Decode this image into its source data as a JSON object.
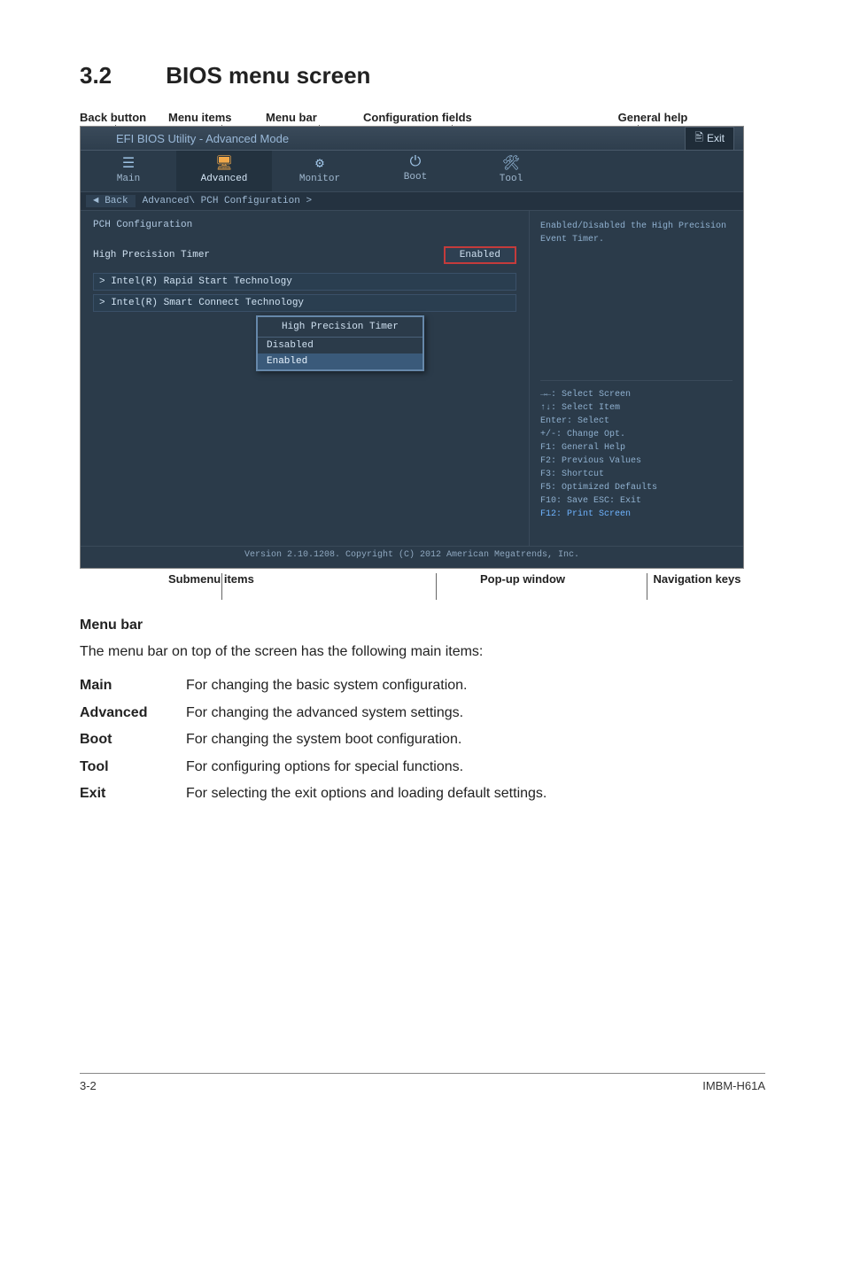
{
  "heading": {
    "num": "3.2",
    "title": "BIOS menu screen"
  },
  "top_labels": [
    "Back button",
    "Menu items",
    "Menu bar",
    "Configuration fields",
    "General help"
  ],
  "bios": {
    "title": "EFI BIOS Utility - Advanced Mode",
    "exit": "Exit",
    "tabs": [
      {
        "icon": "☰",
        "label": "Main"
      },
      {
        "icon": "🖥",
        "label": "Advanced"
      },
      {
        "icon": "⚙",
        "label": "Monitor"
      },
      {
        "icon": "⏻",
        "label": "Boot"
      },
      {
        "icon": "🛠",
        "label": "Tool"
      }
    ],
    "back_button": "Back",
    "breadcrumb": "Advanced\\ PCH Configuration >",
    "left": {
      "section_title": "PCH Configuration",
      "hpt_label": "High Precision Timer",
      "hpt_value": "Enabled",
      "subitems": [
        "> Intel(R) Rapid Start Technology",
        "> Intel(R) Smart Connect Technology"
      ]
    },
    "popup": {
      "title": "High Precision Timer",
      "items": [
        "Disabled",
        "Enabled"
      ],
      "selected": "Enabled"
    },
    "help_text": "Enabled/Disabled the High Precision Event Timer.",
    "nav_keys": [
      "→←: Select Screen",
      "↑↓: Select Item",
      "Enter: Select",
      "+/-: Change Opt.",
      "F1: General Help",
      "F2: Previous Values",
      "F3: Shortcut",
      "F5: Optimized Defaults",
      "F10: Save  ESC: Exit",
      "F12: Print Screen"
    ],
    "footer": "Version 2.10.1208. Copyright (C) 2012 American Megatrends, Inc."
  },
  "bottom_labels": [
    "Submenu items",
    "Pop-up window",
    "Navigation keys"
  ],
  "menu_bar_section": {
    "title": "Menu bar",
    "intro": "The menu bar on top of the screen has the following main items:",
    "rows": [
      {
        "term": "Main",
        "desc": "For changing the basic system configuration."
      },
      {
        "term": "Advanced",
        "desc": "For changing the advanced system settings."
      },
      {
        "term": "Boot",
        "desc": "For changing the system boot configuration."
      },
      {
        "term": "Tool",
        "desc": "For configuring options for special functions."
      },
      {
        "term": "Exit",
        "desc": "For selecting the exit options and loading default settings."
      }
    ]
  },
  "footer": {
    "page": "3-2",
    "model": "IMBM-H61A"
  }
}
